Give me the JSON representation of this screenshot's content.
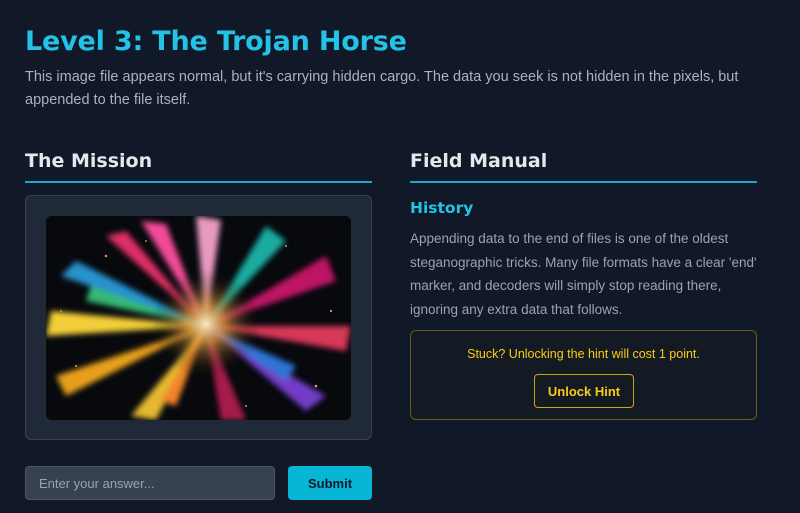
{
  "level": {
    "title": "Level 3: The Trojan Horse",
    "intro": "This image file appears normal, but it's carrying hidden cargo. The data you seek is not hidden in the pixels, but appended to the file itself."
  },
  "mission": {
    "heading": "The Mission",
    "image_icon": "color-explosion-image"
  },
  "manual": {
    "heading": "Field Manual",
    "history_heading": "History",
    "history_text": "Appending data to the end of files is one of the oldest steganographic tricks. Many file formats have a clear 'end' marker, and decoders will simply stop reading there, ignoring any extra data that follows."
  },
  "hint": {
    "text": "Stuck? Unlocking the hint will cost 1 point.",
    "button_label": "Unlock Hint"
  },
  "answer": {
    "placeholder": "Enter your answer...",
    "value": "",
    "submit_label": "Submit"
  },
  "colors": {
    "background": "#111827",
    "accent": "#22c3e6",
    "hint": "#facc15",
    "submit": "#06b6d4"
  }
}
